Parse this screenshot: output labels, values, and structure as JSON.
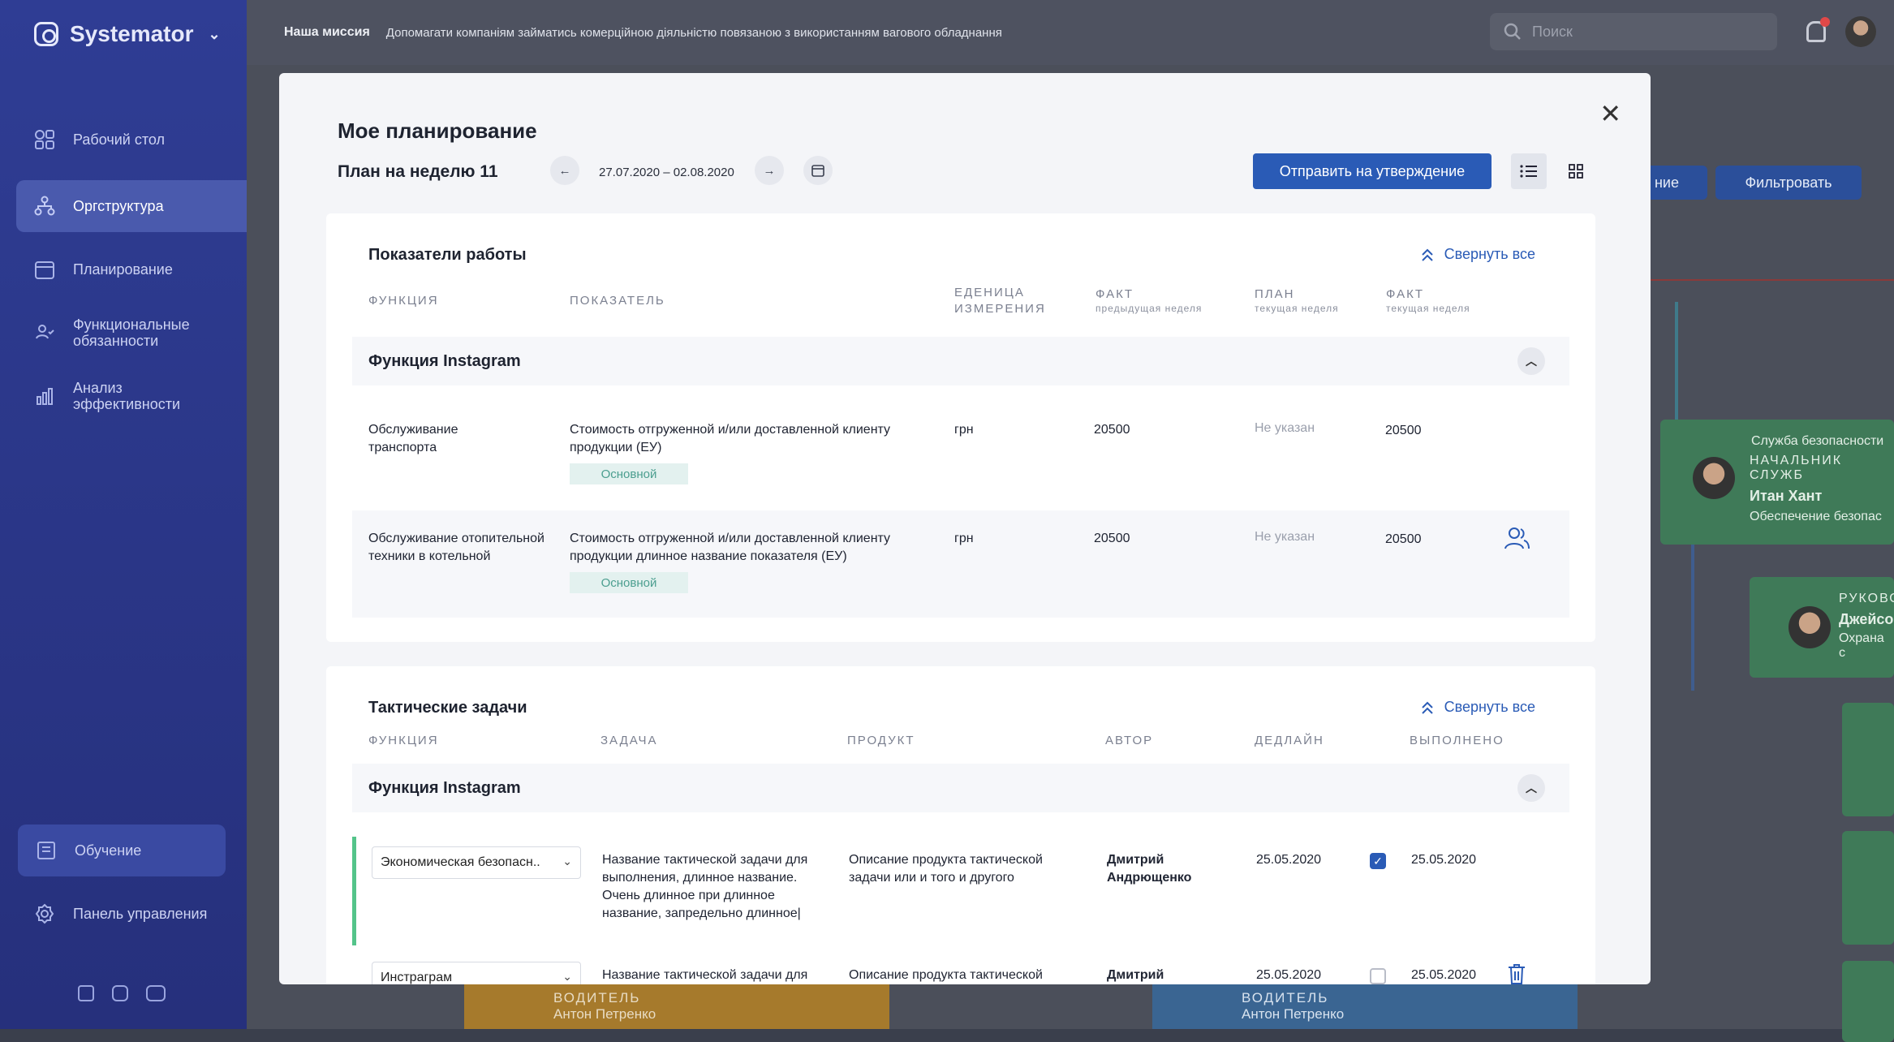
{
  "app": {
    "name": "Systemator"
  },
  "sidebar": {
    "items": [
      {
        "label": "Рабочий стол"
      },
      {
        "label": "Оргструктура"
      },
      {
        "label": "Планирование"
      },
      {
        "label": "Функциональные обязанности"
      },
      {
        "label": "Анализ эффективности"
      },
      {
        "label": "Обучение"
      },
      {
        "label": "Панель управления"
      }
    ],
    "social": [
      "facebook-icon",
      "instagram-icon",
      "youtube-icon"
    ]
  },
  "topbar": {
    "mission_label": "Наша миссия",
    "mission_text": "Допомагати компаніям займатись комерційною діяльністю повязаною з використанням вагового обладнання",
    "search_placeholder": "Поиск"
  },
  "background": {
    "btn_partial": "ние",
    "btn_filter": "Фильтровать",
    "card1_title": "Служба безопасности",
    "card1_role": "НАЧАЛЬНИК СЛУЖБ",
    "card1_name": "Итан Хант",
    "card1_desc": "Обеспечение безопас",
    "card2_role": "РУКОВО",
    "card2_name": "Джейсо",
    "card2_desc": "Охрана с",
    "bottom1_role": "ВОДИТЕЛЬ",
    "bottom1_name": "Антон Петренко",
    "bottom2_role": "ВОДИТЕЛЬ",
    "bottom2_name": "Антон Петренко"
  },
  "modal": {
    "title": "Мое планирование",
    "week": "План на неделю 11",
    "dates": "27.07.2020 – 02.08.2020",
    "send": "Отправить на утверждение",
    "close": "✕"
  },
  "kpi": {
    "title": "Показатели работы",
    "collapse": "Свернуть все",
    "headers": {
      "function": "Функция",
      "indicator": "Показатель",
      "unit1": "Еденица",
      "unit2": "измерения",
      "fact_prev": "Факт",
      "fact_prev_sub": "предыдущая неделя",
      "plan": "План",
      "plan_sub": "текущая неделя",
      "fact_cur": "Факт",
      "fact_cur_sub": "текущая неделя"
    },
    "group": "Функция Instagram",
    "rows": [
      {
        "function": "Обслуживание транспорта",
        "indicator": "Стоимость отгруженной и/или доставленной клиенту продукции (ЕУ)",
        "tag": "Основной",
        "unit": "грн",
        "fact_prev": "20500",
        "plan": "Не указан",
        "fact_cur": "20500"
      },
      {
        "function": "Обслуживание отопительной техники в котельной",
        "indicator": "Стоимость отгруженной и/или доставленной клиенту продукции длинное название показателя (ЕУ)",
        "tag": "Основной",
        "unit": "грн",
        "fact_prev": "20500",
        "plan": "Не указан",
        "fact_cur": "20500"
      }
    ]
  },
  "tasks": {
    "title": "Тактические задачи",
    "collapse": "Свернуть все",
    "headers": {
      "function": "Функция",
      "task": "Задача",
      "product": "Продукт",
      "author": "Автор",
      "deadline": "Дедлайн",
      "done": "Выполнено"
    },
    "group": "Функция Instagram",
    "rows": [
      {
        "function": "Экономическая безопасн..",
        "task": "Название тактической задачи для выполнения, длинное название. Очень длинное при длинное название, запредельно длинное|",
        "product": "Описание продукта тактической задачи или и того и другого",
        "author": "Дмитрий Андрющенко",
        "deadline": "25.05.2020",
        "done_checked": true,
        "done": "25.05.2020"
      },
      {
        "function": "Инстраграм",
        "task": "Название тактической задачи для",
        "product": "Описание продукта тактической",
        "author": "Дмитрий",
        "deadline": "25.05.2020",
        "done_checked": false,
        "done": "25.05.2020"
      }
    ]
  }
}
